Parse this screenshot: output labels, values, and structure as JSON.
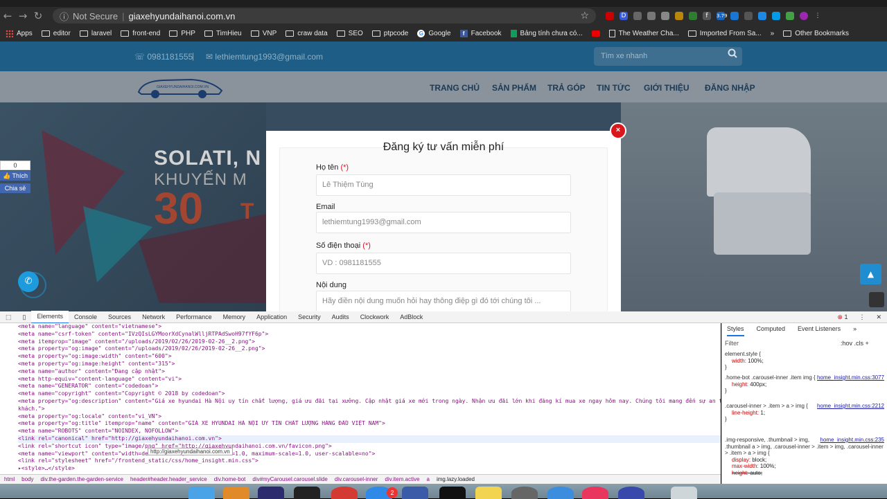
{
  "browser": {
    "security_label": "Not Secure",
    "url": "giaxehyundaihanoi.com.vn",
    "ext_badge": "3.79",
    "bookmarks": [
      "Apps",
      "editor",
      "laravel",
      "front-end",
      "PHP",
      "TimHieu",
      "VNP",
      "craw data",
      "SEO",
      "ptpcode",
      "Google",
      "Facebook",
      "Bảng tính chưa có...",
      "",
      "The Weather Cha...",
      "Imported From Sa...",
      "»",
      "Other Bookmarks"
    ]
  },
  "site": {
    "phone": "0981181555",
    "pipe": "|",
    "email": "lethiemtung1993@gmail.com",
    "search_placeholder": "Tìm xe nhanh",
    "menu": [
      "TRANG CHỦ",
      "SẢN PHẨM",
      "TRẢ GÓP",
      "TIN TỨC",
      "GIỚI THIỆU",
      "ĐĂNG NHẬP"
    ],
    "logo_text": "GIAXEHYUNDAIHANOI.COM.VN",
    "hero": {
      "line1": "SOLATI, N",
      "line2": "KHUYẾN M",
      "big": "30",
      "big_suffix": "T"
    },
    "fb_count": "0",
    "fb_like": "Thích",
    "fb_share": "Chia sẻ"
  },
  "modal": {
    "close": "×",
    "title": "Đăng ký tư vấn miễn phí",
    "required_mark": "(*)",
    "fields": [
      {
        "label": "Họ tên",
        "required": true,
        "placeholder": "Lê Thiệm Tùng"
      },
      {
        "label": "Email",
        "required": false,
        "placeholder": "lethiemtung1993@gmail.com"
      },
      {
        "label": "Số điện thoại",
        "required": true,
        "placeholder": "VD : 0981181555"
      },
      {
        "label": "Nội dung",
        "required": false,
        "placeholder": "Hãy điền nội dung muốn hỏi hay thông điệp gì đó tới chúng tôi ..."
      }
    ]
  },
  "devtools": {
    "tabs": [
      "Elements",
      "Console",
      "Sources",
      "Network",
      "Performance",
      "Memory",
      "Application",
      "Security",
      "Audits",
      "Clockwork",
      "AdBlock"
    ],
    "error_count": "1",
    "more": "»",
    "lines": [
      "<meta name=\"language\" content=\"vietnamese\">",
      "<meta name=\"csrf-token\" content=\"IVzQIsLGYMoorXdCynalWlljRTPAdSwoH97fYF6p\">",
      "<meta itemprop=\"image\" content=\"/uploads/2019/02/26/2019-02-26__2.png\">",
      "<meta property=\"og:image\" content=\"/uploads/2019/02/26/2019-02-26__2.png\">",
      "<meta property=\"og:image:width\" content=\"600\">",
      "<meta property=\"og:image:height\" content=\"315\">",
      "<meta name=\"author\" content=\"Đang cập nhật\">",
      "<meta http-equiv=\"content-language\" content=\"vi\">",
      "<meta name=\"GENERATOR\" content=\"codedoan\">",
      "<meta name=\"copyright\" content=\"Copyright © 2018 by codedoan\">",
      "<meta property=\"og:description\" content=\"Giá xe hyundai Hà Nội uy tín chất lượng, giá ưu đãi tại xưởng. Cập nhật giá xe mới trong ngày. Nhận ưu đãi lớn khi đăng kí mua xe ngay hôm nay. Chúng tôi mang đến sự an tâm cho quý",
      "khách.\">",
      "<meta property=\"og:locale\" content=\"vi_VN\">",
      "<meta property=\"og:title\" itemprop=\"name\" content=\"GIÁ XE HYUNDAI HÀ NỘI UY TÍN CHẤT LƯỢNG HÀNG ĐẦU VIỆT NAM\">",
      "<meta name=\"ROBOTS\" content=\"NOINDEX, NOFOLLOW\">",
      "<link rel=\"canonical\" href=\"http://giaxehyundaihanoi.com.vn\">",
      "<link rel=\"shortcut icon\" type=\"image/png\" href=\"http://giaxehyundaihanoi.com.vn/favicon.png\">",
      "<meta name=\"viewport\" content=\"width=device-width, initial-scale=1.0, maximum-scale=1.0, user-scalable=no\">",
      "<link rel=\"stylesheet\" href=\"/frontend_static/css/home_insight.min.css\">",
      "▸<style>…</style>"
    ],
    "tooltip": "http://giaxehyundaihanoi.com.vn",
    "styles_tabs": [
      "Styles",
      "Computed",
      "Event Listeners",
      "»"
    ],
    "filter": "Filter",
    "filter_right": ":hov  .cls  +",
    "rules": [
      {
        "sel": "element.style {",
        "src": "",
        "props": [
          [
            "width",
            "100%;"
          ]
        ]
      },
      {
        "sel": ".home-bot .carousel-inner .item img {",
        "src": "home_insight.min.css:3077",
        "props": [
          [
            "height",
            "400px;"
          ]
        ]
      },
      {
        "sel": ".carousel-inner > .item > a > img {",
        "src": "home_insight.min.css:2212",
        "props": [
          [
            "line-height",
            "1;"
          ]
        ]
      },
      {
        "sel": ".img-responsive, .thumbnail > img, .thumbnail a > img, .carousel-inner > .item > img, .carousel-inner > .item > a > img {",
        "src": "home_insight.min.css:235",
        "props": [
          [
            "display",
            "block;"
          ],
          [
            "max-width",
            "100%;"
          ],
          [
            "height",
            "auto;"
          ]
        ]
      }
    ],
    "breadcrumbs": [
      "html",
      "body",
      "div.the-garden.the-garden-service",
      "header#header.header_service",
      "div.home-bot",
      "div#myCarousel.carousel.slide",
      "div.carousel-inner",
      "div.item.active",
      "a",
      "img.lazy.loaded"
    ]
  },
  "colors": {
    "topbar": "#1d5d86",
    "close": "#d9181e",
    "required": "#dd1122",
    "call": "#1d9bdc"
  }
}
